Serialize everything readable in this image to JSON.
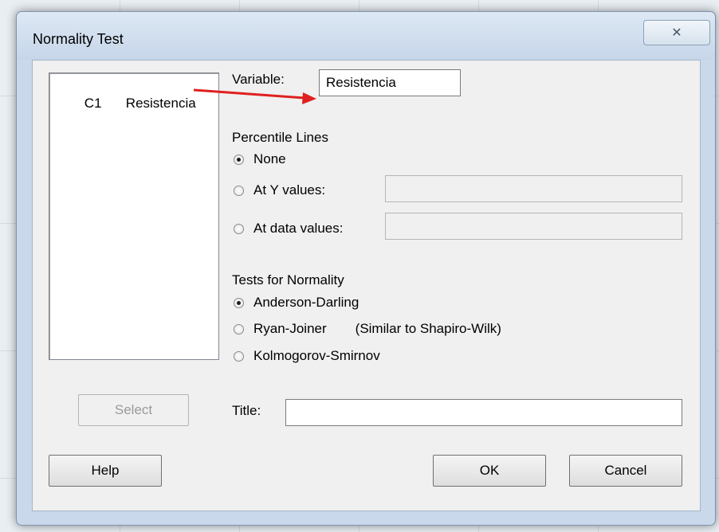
{
  "dialog": {
    "title": "Normality Test",
    "close_icon": "close-x-icon"
  },
  "columns_list": {
    "items": [
      {
        "id": "C1",
        "name": "Resistencia"
      }
    ]
  },
  "variable": {
    "label": "Variable:",
    "value": "Resistencia"
  },
  "percentile_lines": {
    "heading": "Percentile Lines",
    "options": [
      {
        "label": "None",
        "checked": true
      },
      {
        "label": "At Y values:",
        "checked": false,
        "field_value": ""
      },
      {
        "label": "At data values:",
        "checked": false,
        "field_value": ""
      }
    ]
  },
  "tests_for_normality": {
    "heading": "Tests for Normality",
    "options": [
      {
        "label": "Anderson-Darling",
        "checked": true
      },
      {
        "label": "Ryan-Joiner",
        "note": "(Similar to Shapiro-Wilk)",
        "checked": false
      },
      {
        "label": "Kolmogorov-Smirnov",
        "checked": false
      }
    ]
  },
  "title_field": {
    "label": "Title:",
    "value": ""
  },
  "buttons": {
    "select": "Select",
    "help": "Help",
    "ok": "OK",
    "cancel": "Cancel"
  },
  "colors": {
    "annotation_arrow": "#e02020"
  }
}
